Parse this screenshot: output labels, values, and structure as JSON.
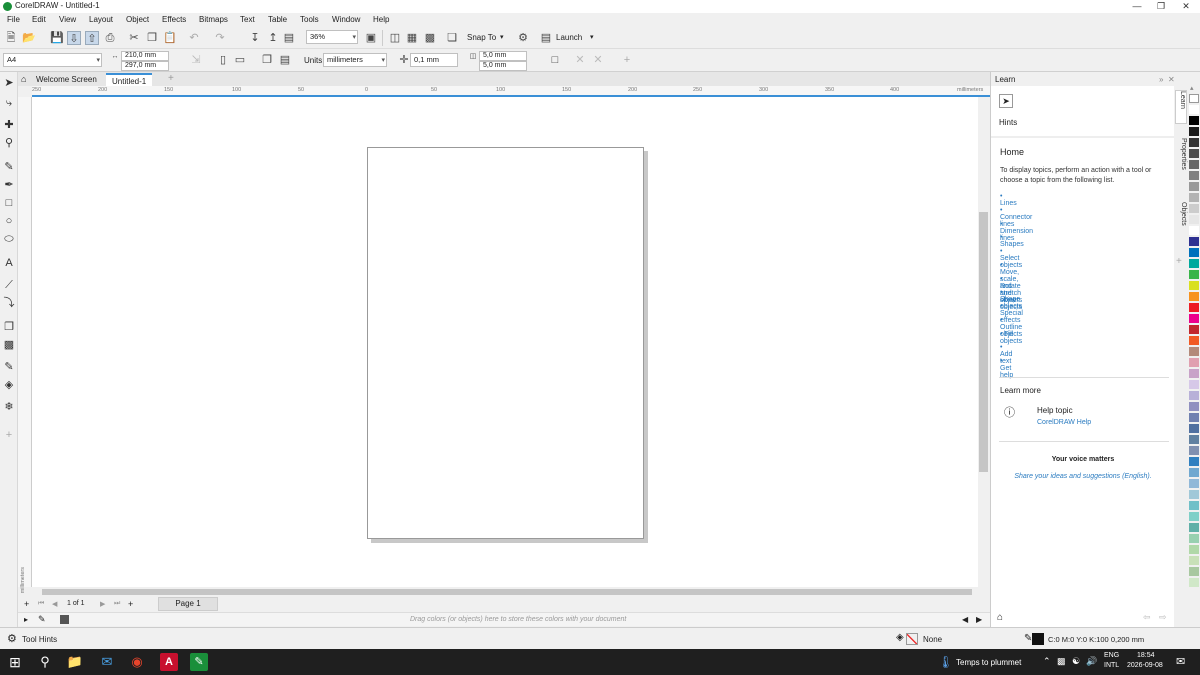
{
  "window": {
    "title": "CorelDRAW - Untitled-1"
  },
  "menu": [
    "File",
    "Edit",
    "View",
    "Layout",
    "Object",
    "Effects",
    "Bitmaps",
    "Text",
    "Table",
    "Tools",
    "Window",
    "Help"
  ],
  "stdbar": {
    "zoom": "36%",
    "snap": "Snap To",
    "launch": "Launch"
  },
  "propbar": {
    "page_size": "A4",
    "width": "210,0 mm",
    "height": "297,0 mm",
    "units_label": "Units:",
    "units": "millimeters",
    "nudge": "0,1 mm",
    "dup_x": "5,0 mm",
    "dup_y": "5,0 mm"
  },
  "tabs": {
    "welcome": "Welcome Screen",
    "doc": "Untitled-1"
  },
  "ruler": {
    "h_ticks": [
      "250",
      "200",
      "150",
      "100",
      "50",
      "0",
      "50",
      "100",
      "150",
      "200",
      "250",
      "300",
      "350",
      "400"
    ],
    "unit": "millimeters",
    "v_label": "millimeters"
  },
  "pagenav": {
    "counter": "1 of 1",
    "page": "Page 1"
  },
  "colortray": {
    "hint": "Drag colors (or objects) here to store these colors with your document"
  },
  "learn": {
    "header": "Learn",
    "hints_label": "Hints",
    "home_title": "Home",
    "intro": "To display topics, perform an action with a tool or choose a topic from the following list.",
    "topics": [
      "Lines",
      "Connector lines",
      "Dimension lines",
      "Shapes",
      "Select objects",
      "Move, scale, and stretch objects",
      "Rotate and skew objects",
      "Shape objects",
      "Special effects",
      "Outline objects",
      "Fill objects",
      "Add text",
      "Get help"
    ],
    "learn_more": "Learn more",
    "help_topic": "Help topic",
    "help_link": "CorelDRAW Help",
    "voice_title": "Your voice matters",
    "voice_link": "Share your ideas and suggestions (English)."
  },
  "sidetabs": [
    "Learn",
    "Properties",
    "Objects"
  ],
  "palette": [
    "#ffffff",
    "#000000",
    "#1a1a1a",
    "#333333",
    "#4d4d4d",
    "#666666",
    "#808080",
    "#999999",
    "#b3b3b3",
    "#cccccc",
    "#e6e6e6",
    "#ffffff",
    "#2e3192",
    "#0071bc",
    "#00a99d",
    "#39b54a",
    "#d9e021",
    "#f7931e",
    "#ed1c24",
    "#ec008c",
    "#c1272d",
    "#f15a24",
    "#b38a7a",
    "#e0a0b0",
    "#c8a2c8",
    "#d6c8e8",
    "#b8b0d8",
    "#9090c0",
    "#7080b0",
    "#5070a0",
    "#6080a0",
    "#8090b0",
    "#3080c0",
    "#70a8d0",
    "#90b8d8",
    "#a0c8d8",
    "#70c0c8",
    "#80d0c8",
    "#60b0a8",
    "#98d0b0",
    "#b0d8a8",
    "#c8e0b8",
    "#a8c8a0",
    "#d0e8c8"
  ],
  "status": {
    "tool_hints": "Tool Hints",
    "fill": "None",
    "outline": "C:0 M:0 Y:0 K:100  0,200 mm"
  },
  "taskbar": {
    "weather": "Temps to plummet",
    "lang1": "ENG",
    "lang2": "INTL",
    "time": "18:54",
    "date": "2026-09-08"
  }
}
